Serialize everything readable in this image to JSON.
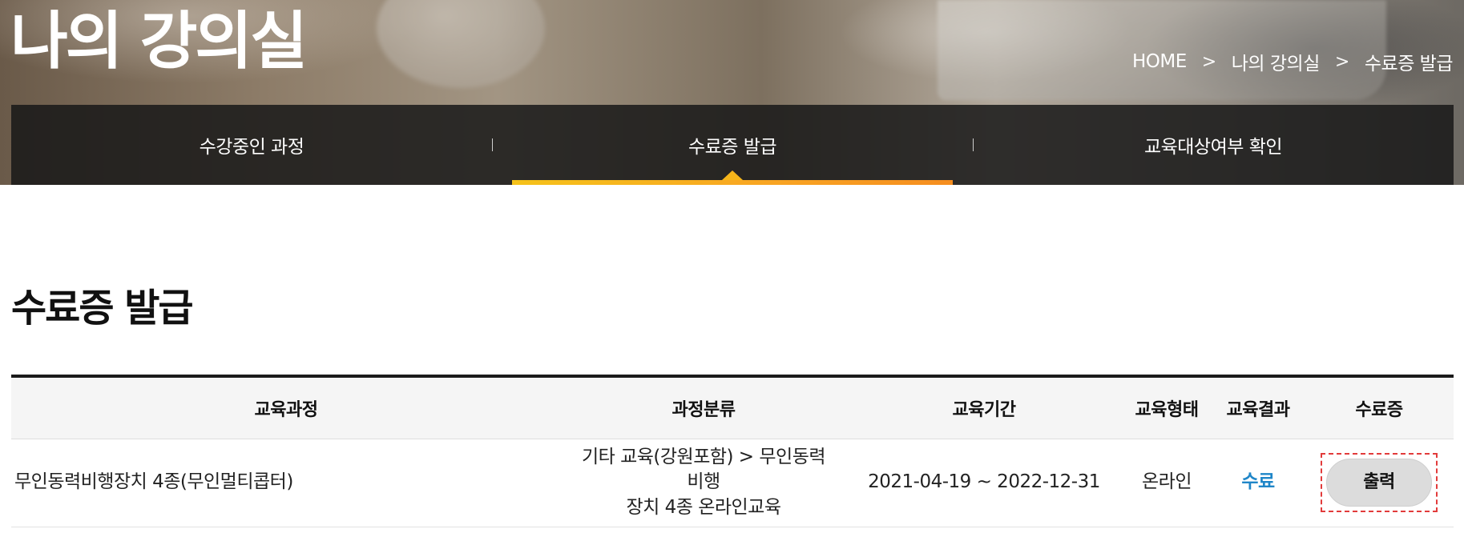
{
  "hero": {
    "title": "나의 강의실"
  },
  "breadcrumb": {
    "items": [
      "HOME",
      "나의 강의실",
      "수료증 발급"
    ],
    "separator": ">"
  },
  "tabs": [
    {
      "label": "수강중인 과정",
      "active": false
    },
    {
      "label": "수료증 발급",
      "active": true
    },
    {
      "label": "교육대상여부 확인",
      "active": false
    }
  ],
  "section": {
    "title": "수료증 발급"
  },
  "table": {
    "headers": [
      "교육과정",
      "과정분류",
      "교육기간",
      "교육형태",
      "교육결과",
      "수료증"
    ],
    "rows": [
      {
        "course": "무인동력비행장치 4종(무인멀티콥터)",
        "category_line1": "기타 교육(강원포함) > 무인동력비행",
        "category_line2": "장치 4종 온라인교육",
        "period": "2021-04-19 ~ 2022-12-31",
        "type": "온라인",
        "result": "수료",
        "action_label": "출력"
      }
    ]
  },
  "colors": {
    "accent": "#f5b51a",
    "result_link": "#1f86c8",
    "tab_bar": "#181818",
    "highlight_border": "#e23b3b"
  }
}
